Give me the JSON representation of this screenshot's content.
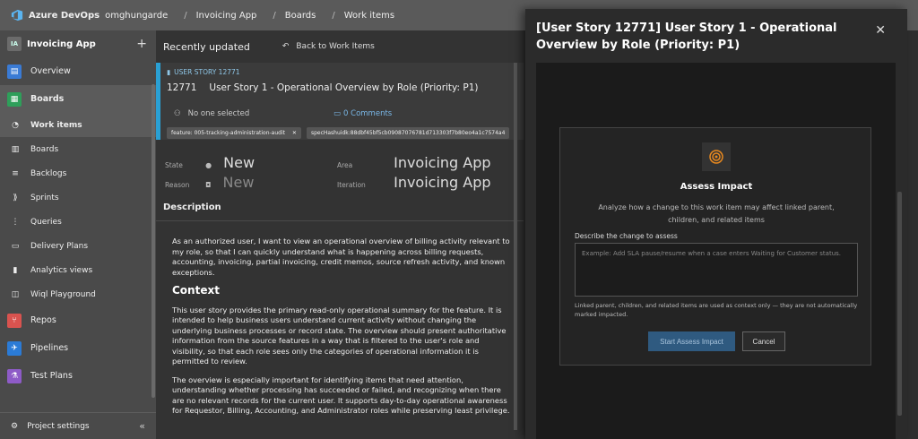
{
  "topbar": {
    "brand": "Azure DevOps",
    "org": "omghungarde",
    "project": "Invoicing App",
    "section": "Boards",
    "page": "Work items"
  },
  "sidebar": {
    "project_initials": "IA",
    "project_name": "Invoicing App",
    "items": [
      {
        "label": "Overview",
        "icon": "overview-icon",
        "color": "#3a7bd5"
      },
      {
        "label": "Boards",
        "icon": "boards-icon",
        "color": "#2e9f5a"
      },
      {
        "label": "Work items",
        "icon": "work-items-icon"
      },
      {
        "label": "Boards",
        "icon": "board-icon"
      },
      {
        "label": "Backlogs",
        "icon": "backlogs-icon"
      },
      {
        "label": "Sprints",
        "icon": "sprints-icon"
      },
      {
        "label": "Queries",
        "icon": "queries-icon"
      },
      {
        "label": "Delivery Plans",
        "icon": "delivery-plans-icon"
      },
      {
        "label": "Analytics views",
        "icon": "analytics-icon"
      },
      {
        "label": "Wiql Playground",
        "icon": "wiql-icon"
      },
      {
        "label": "Repos",
        "icon": "repos-icon",
        "color": "#d9534f"
      },
      {
        "label": "Pipelines",
        "icon": "pipelines-icon",
        "color": "#2b7bd6"
      },
      {
        "label": "Test Plans",
        "icon": "test-plans-icon",
        "color": "#8e5bc7"
      }
    ],
    "settings": "Project settings"
  },
  "main": {
    "recent": "Recently updated",
    "back": "Back to Work Items",
    "type": "USER STORY 12771",
    "id": "12771",
    "title": "User Story 1 - Operational Overview by Role (Priority: P1)",
    "assigned": "No one selected",
    "comments": "0 Comments",
    "tags": [
      "feature: 005-tracking-administration-audit",
      "specHashuidk:88dbf45bf5cb09087076781d713303f7b80eo4a1c7574a4"
    ],
    "state_label": "State",
    "state": "New",
    "reason_label": "Reason",
    "reason": "New",
    "area_label": "Area",
    "area": "Invoicing App",
    "iteration_label": "Iteration",
    "iteration": "Invoicing App",
    "description_h": "Description",
    "p1": "As an authorized user, I want to view an operational overview of billing activity relevant to my role, so that I can quickly understand what is happening across billing requests, accounting, invoicing, partial invoicing, credit memos, source refresh activity, and known exceptions.",
    "context_h": "Context",
    "p2": "This user story provides the primary read-only operational summary for the feature. It is intended to help business users understand current activity without changing the underlying business processes or record state. The overview should present authoritative information from the source features in a way that is filtered to the user's role and visibility, so that each role sees only the categories of operational information it is permitted to review.",
    "p3": "The overview is especially important for identifying items that need attention, understanding whether processing has succeeded or failed, and recognizing when there are no relevant records for the current user. It supports day-to-day operational awareness for Requestor, Billing, Accounting, and Administrator roles while preserving least privilege."
  },
  "panel": {
    "title": "[User Story 12771] User Story 1 - Operational Overview by Role (Priority: P1)",
    "dialog_title": "Assess Impact",
    "dialog_sub": "Analyze how a change to this work item may affect linked parent, children, and related items",
    "input_label": "Describe the change to assess",
    "input_placeholder": "Example: Add SLA pause/resume when a case enters Waiting for Customer status.",
    "note": "Linked parent, children, and related items are used as context only — they are not automatically marked impacted.",
    "start_btn": "Start Assess Impact",
    "cancel_btn": "Cancel"
  }
}
